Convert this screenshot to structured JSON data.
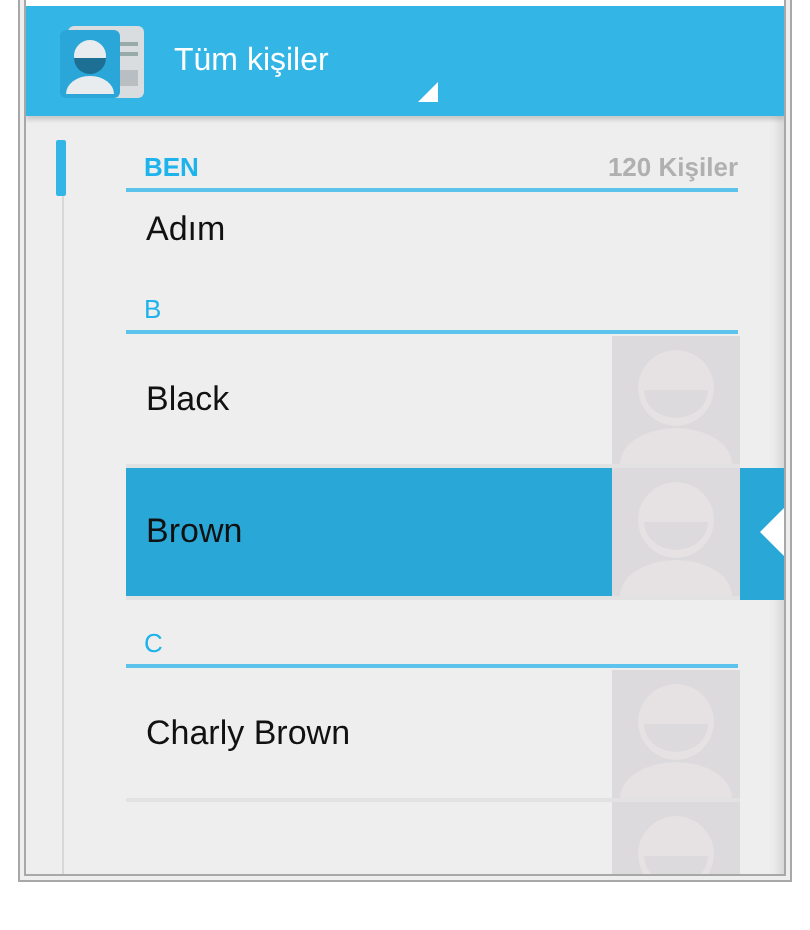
{
  "header": {
    "title": "Tüm kişiler"
  },
  "sections": [
    {
      "letter": "BEN",
      "count": "120 Kişiler",
      "contacts": [
        {
          "name": "Adım",
          "kind": "me",
          "selected": false
        }
      ]
    },
    {
      "letter": "B",
      "contacts": [
        {
          "name": "Black",
          "kind": "contact",
          "selected": false
        },
        {
          "name": "Brown",
          "kind": "contact",
          "selected": true
        }
      ]
    },
    {
      "letter": "C",
      "contacts": [
        {
          "name": "Charly Brown",
          "kind": "contact",
          "selected": false
        },
        {
          "kind": "contact",
          "selected": false
        }
      ]
    }
  ]
}
